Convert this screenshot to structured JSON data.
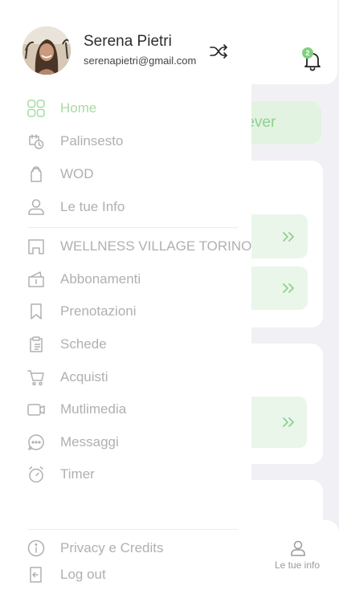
{
  "user": {
    "name": "Serena Pietri",
    "email": "serenapietri@gmail.com"
  },
  "menu": [
    {
      "label": "Home",
      "icon": "grid-icon",
      "active": true
    },
    {
      "label": "Palinsesto",
      "icon": "schedule-icon"
    },
    {
      "label": "WOD",
      "icon": "kettlebell-icon"
    },
    {
      "label": "Le tue Info",
      "icon": "user-icon"
    }
  ],
  "menu2": [
    {
      "label": "WELLNESS VILLAGE TORINO",
      "icon": "gym-icon"
    },
    {
      "label": "Abbonamenti",
      "icon": "subscription-icon"
    },
    {
      "label": "Prenotazioni",
      "icon": "bookmark-icon"
    },
    {
      "label": "Schede",
      "icon": "clipboard-icon"
    },
    {
      "label": "Acquisti",
      "icon": "cart-icon"
    },
    {
      "label": "Mutlimedia",
      "icon": "video-icon"
    },
    {
      "label": "Messaggi",
      "icon": "chat-icon"
    },
    {
      "label": "Timer",
      "icon": "timer-icon"
    }
  ],
  "footer": [
    {
      "label": "Privacy e Credits",
      "icon": "info-icon"
    },
    {
      "label": "Log out",
      "icon": "logout-icon"
    }
  ],
  "background": {
    "notification_count": "2",
    "highlight_text": "rever",
    "tab_label": "Le tue info"
  },
  "colors": {
    "accent": "#a6dba5",
    "muted_text": "#b0b0b0"
  }
}
